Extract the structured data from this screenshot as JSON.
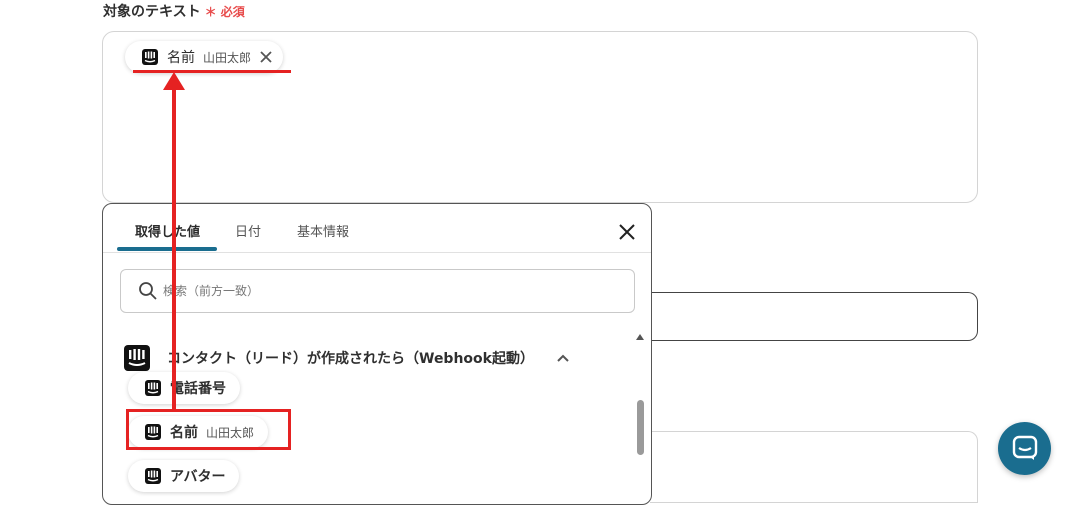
{
  "field": {
    "label": "対象のテキスト",
    "required_mark": "＊ 必須",
    "chip": {
      "name": "名前",
      "value": "山田太郎",
      "icon": "intercom-icon",
      "remove_icon": "close-icon"
    }
  },
  "popover": {
    "tabs": [
      "取得した値",
      "日付",
      "基本情報"
    ],
    "active_tab": "取得した値",
    "close_icon": "close-icon",
    "search": {
      "placeholder": "検索（前方一致）",
      "value": "",
      "icon": "search-icon"
    },
    "group": {
      "title": "コンタクト（リード）が作成されたら（Webhook起動）",
      "icon": "intercom-icon",
      "toggle_icon": "chevron-up-icon"
    },
    "items": [
      {
        "name": "電話番号",
        "value": "",
        "icon": "intercom-icon"
      },
      {
        "name": "名前",
        "value": "山田太郎",
        "icon": "intercom-icon",
        "highlighted": true
      },
      {
        "name": "アバター",
        "value": "",
        "icon": "intercom-icon"
      }
    ]
  },
  "chat_widget": {
    "icon": "chat-icon"
  },
  "colors": {
    "accent": "#1a6d8f",
    "required": "#e84c4c",
    "annotation": "#e52222"
  }
}
